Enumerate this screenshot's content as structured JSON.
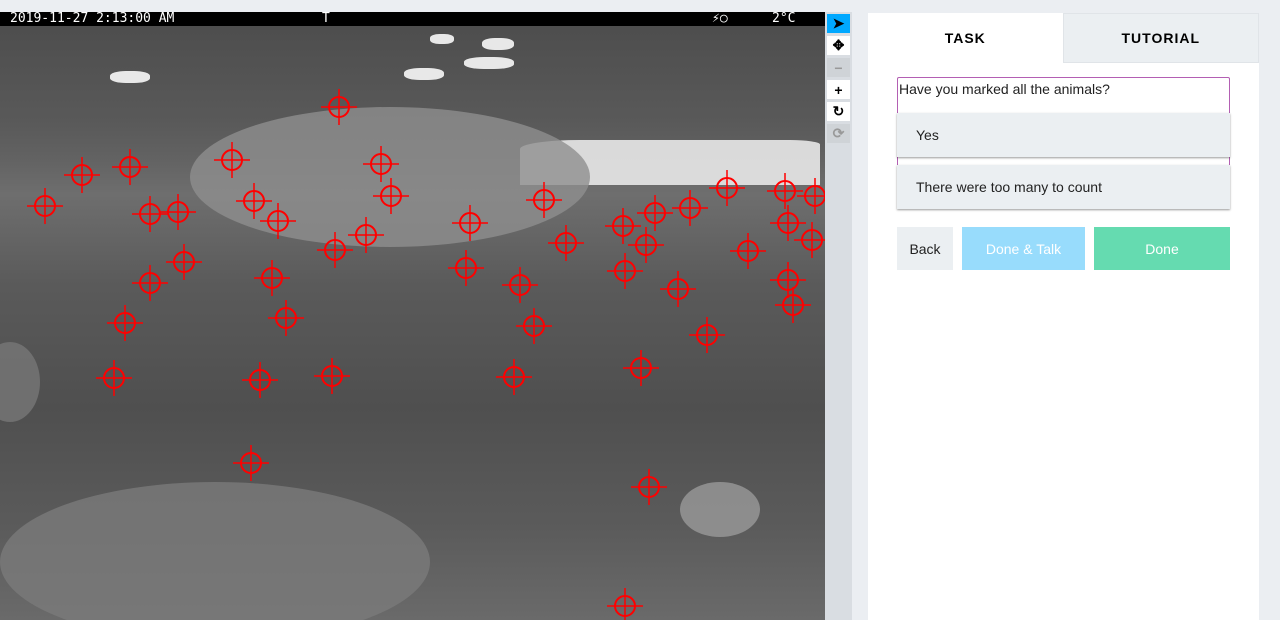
{
  "image_info": {
    "timestamp": "2019-11-27 2:13:00 AM",
    "flag": "T",
    "moon_icon": "moon-phase-icon",
    "temperature": "2°C"
  },
  "toolbar": {
    "tools": [
      {
        "name": "pointer-tool",
        "glyph": "➤"
      },
      {
        "name": "pan-tool",
        "glyph": "✥"
      },
      {
        "name": "zoom-out-tool",
        "glyph": "−"
      },
      {
        "name": "zoom-in-tool",
        "glyph": "+"
      },
      {
        "name": "rotate-tool",
        "glyph": "↻"
      },
      {
        "name": "reset-tool",
        "glyph": "⟳"
      }
    ]
  },
  "panel": {
    "tabs": [
      {
        "label": "TASK"
      },
      {
        "label": "TUTORIAL"
      }
    ],
    "question": "Have you marked all the animals?",
    "answers": [
      {
        "label": "Yes"
      },
      {
        "label": "There were too many to count"
      }
    ],
    "buttons": {
      "back": "Back",
      "done_talk": "Done & Talk",
      "done": "Done"
    }
  },
  "colors": {
    "marker": "#ff0000",
    "active_tool": "#00a8ff",
    "done_talk": "#98dcfc",
    "done": "#65dbb0",
    "question_border": "#b35fb3"
  }
}
